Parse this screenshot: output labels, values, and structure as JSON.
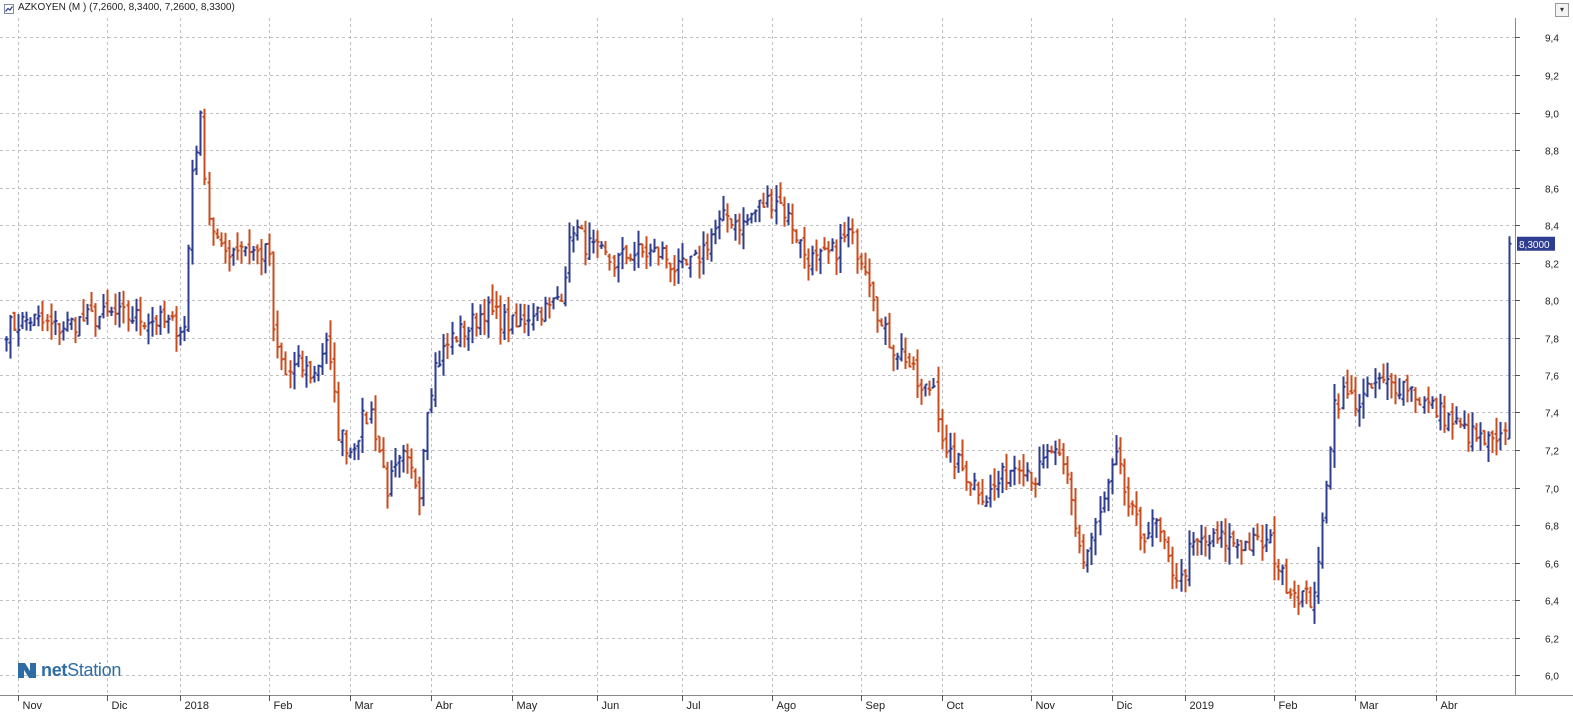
{
  "window": {
    "title": "AZKOYEN (M ) (7,2600, 8,3400, 7,2600, 8,3300)",
    "close_glyph": "▾"
  },
  "logo": {
    "prefix": "net",
    "name": "Station"
  },
  "colors": {
    "up": "#2e3d8f",
    "down": "#c94c1e",
    "grid": "#c0c0c0",
    "price_badge": "#2e3d8f",
    "logo": "#2e6da4"
  },
  "chart_data": {
    "type": "ohlc",
    "symbol": "AZKOYEN (M )",
    "last_price_label": "8,3000",
    "last_bar": {
      "open": 7.26,
      "high": 8.34,
      "low": 7.26,
      "close": 8.3
    },
    "y_axis": {
      "position": "right",
      "ylim": [
        5.95,
        9.45
      ],
      "ticks": [
        "6,0",
        "6,2",
        "6,4",
        "6,6",
        "6,8",
        "7,0",
        "7,2",
        "7,4",
        "7,6",
        "7,8",
        "8,0",
        "8,2",
        "8,4",
        "8,6",
        "8,8",
        "9,0",
        "9,2",
        "9,4"
      ]
    },
    "x_axis": {
      "months": [
        {
          "label": "Nov",
          "index": 4
        },
        {
          "label": "Dic",
          "index": 26
        },
        {
          "label": "2018",
          "index": 44
        },
        {
          "label": "Feb",
          "index": 66
        },
        {
          "label": "Mar",
          "index": 86
        },
        {
          "label": "Abr",
          "index": 106
        },
        {
          "label": "May",
          "index": 126
        },
        {
          "label": "Jun",
          "index": 147
        },
        {
          "label": "Jul",
          "index": 168
        },
        {
          "label": "Ago",
          "index": 190
        },
        {
          "label": "Sep",
          "index": 212
        },
        {
          "label": "Oct",
          "index": 232
        },
        {
          "label": "Nov",
          "index": 254
        },
        {
          "label": "Dic",
          "index": 274
        },
        {
          "label": "2019",
          "index": 292
        },
        {
          "label": "Feb",
          "index": 314
        },
        {
          "label": "Mar",
          "index": 334
        },
        {
          "label": "Abr",
          "index": 354
        }
      ]
    },
    "grid": true,
    "anchors": [
      [
        0,
        7.85
      ],
      [
        6,
        7.9
      ],
      [
        12,
        7.85
      ],
      [
        20,
        7.9
      ],
      [
        26,
        7.92
      ],
      [
        35,
        7.9
      ],
      [
        44,
        7.85
      ],
      [
        46,
        8.7
      ],
      [
        48,
        8.95
      ],
      [
        50,
        8.45
      ],
      [
        53,
        8.25
      ],
      [
        58,
        8.3
      ],
      [
        62,
        8.25
      ],
      [
        65,
        8.25
      ],
      [
        66,
        7.8
      ],
      [
        69,
        7.6
      ],
      [
        72,
        7.65
      ],
      [
        76,
        7.6
      ],
      [
        79,
        7.8
      ],
      [
        82,
        7.3
      ],
      [
        85,
        7.2
      ],
      [
        88,
        7.35
      ],
      [
        90,
        7.4
      ],
      [
        94,
        7.0
      ],
      [
        98,
        7.15
      ],
      [
        102,
        7.0
      ],
      [
        104,
        7.45
      ],
      [
        106,
        7.65
      ],
      [
        110,
        7.8
      ],
      [
        114,
        7.85
      ],
      [
        118,
        7.95
      ],
      [
        122,
        7.9
      ],
      [
        126,
        7.85
      ],
      [
        130,
        7.95
      ],
      [
        134,
        7.95
      ],
      [
        137,
        8.05
      ],
      [
        140,
        8.4
      ],
      [
        143,
        8.3
      ],
      [
        146,
        8.25
      ],
      [
        150,
        8.2
      ],
      [
        154,
        8.25
      ],
      [
        158,
        8.25
      ],
      [
        162,
        8.25
      ],
      [
        166,
        8.15
      ],
      [
        170,
        8.2
      ],
      [
        174,
        8.35
      ],
      [
        178,
        8.45
      ],
      [
        182,
        8.4
      ],
      [
        186,
        8.5
      ],
      [
        190,
        8.55
      ],
      [
        194,
        8.4
      ],
      [
        197,
        8.25
      ],
      [
        200,
        8.2
      ],
      [
        204,
        8.25
      ],
      [
        208,
        8.35
      ],
      [
        212,
        8.2
      ],
      [
        214,
        8.05
      ],
      [
        216,
        7.85
      ],
      [
        219,
        7.75
      ],
      [
        222,
        7.7
      ],
      [
        226,
        7.5
      ],
      [
        229,
        7.55
      ],
      [
        232,
        7.15
      ],
      [
        234,
        7.15
      ],
      [
        238,
        7.05
      ],
      [
        242,
        6.95
      ],
      [
        246,
        7.05
      ],
      [
        250,
        7.15
      ],
      [
        254,
        7.05
      ],
      [
        258,
        7.2
      ],
      [
        262,
        7.05
      ],
      [
        264,
        6.8
      ],
      [
        266,
        6.6
      ],
      [
        270,
        6.85
      ],
      [
        274,
        7.15
      ],
      [
        277,
        6.9
      ],
      [
        280,
        6.75
      ],
      [
        284,
        6.8
      ],
      [
        287,
        6.6
      ],
      [
        290,
        6.5
      ],
      [
        292,
        6.65
      ],
      [
        294,
        6.7
      ],
      [
        300,
        6.72
      ],
      [
        306,
        6.7
      ],
      [
        312,
        6.7
      ],
      [
        315,
        6.52
      ],
      [
        318,
        6.45
      ],
      [
        322,
        6.4
      ],
      [
        324,
        6.55
      ],
      [
        326,
        7.05
      ],
      [
        328,
        7.45
      ],
      [
        330,
        7.5
      ],
      [
        334,
        7.45
      ],
      [
        338,
        7.55
      ],
      [
        342,
        7.55
      ],
      [
        346,
        7.55
      ],
      [
        350,
        7.45
      ],
      [
        354,
        7.4
      ],
      [
        357,
        7.35
      ],
      [
        360,
        7.3
      ],
      [
        364,
        7.25
      ],
      [
        368,
        7.22
      ],
      [
        370,
        7.26
      ]
    ]
  }
}
